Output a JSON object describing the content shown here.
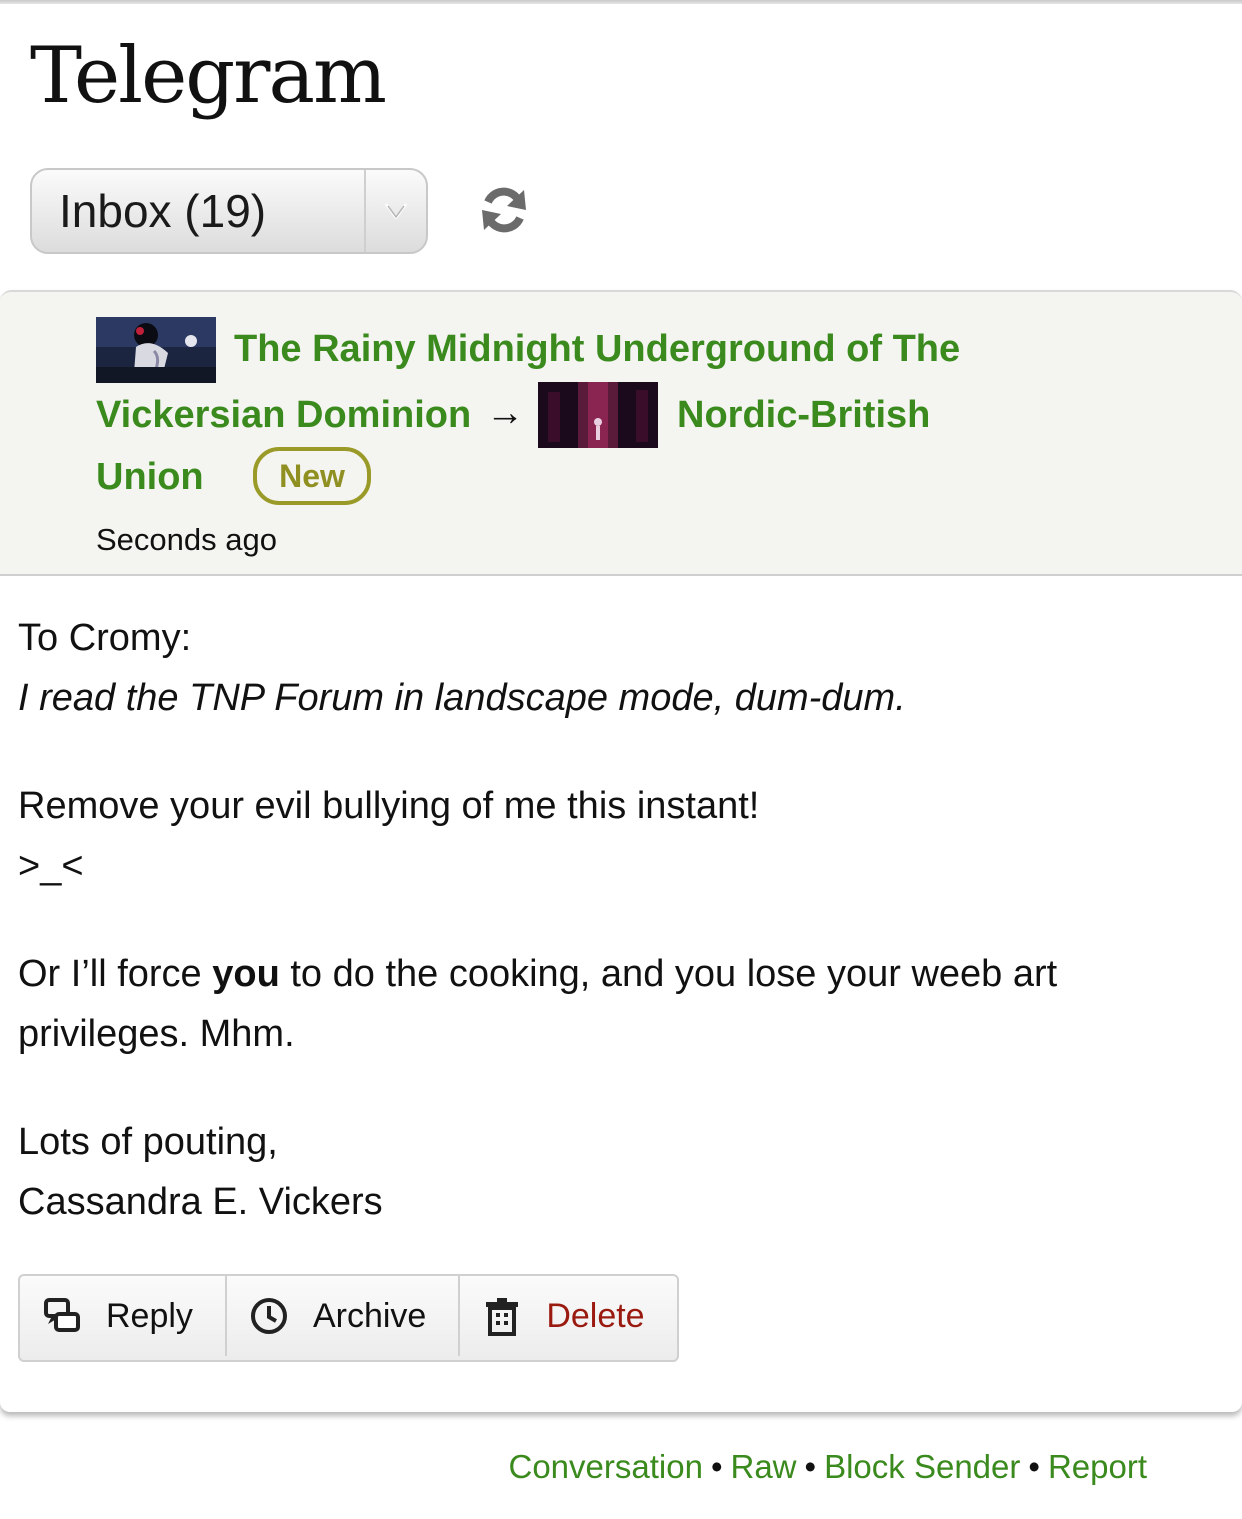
{
  "page": {
    "title": "Telegram"
  },
  "folder": {
    "selected": "Inbox (19)"
  },
  "icons": {
    "refresh": "refresh-icon",
    "dropdown": "chevron-down-icon",
    "reply": "reply-icon",
    "archive": "clock-icon",
    "delete": "trash-icon"
  },
  "telegram": {
    "sender": {
      "name_line1": "The Rainy Midnight Underground of The",
      "name_line2": "Vickersian Dominion"
    },
    "arrow": "→",
    "recipient": {
      "name_line1": "Nordic-British",
      "name_line2": "Union"
    },
    "badge": "New",
    "timestamp": "Seconds ago",
    "body": {
      "greeting": "To Cromy:",
      "italic_line": "I read the TNP Forum in landscape mode, dum-dum.",
      "line3": "Remove your evil bullying of me this instant!",
      "line4": ">_<",
      "line5_pre": "Or I’ll force ",
      "line5_bold": "you",
      "line5_post": " to do the cooking, and you lose your weeb art",
      "line6": "privileges. Mhm.",
      "signoff": "Lots of pouting,",
      "signature": "Cassandra E. Vickers"
    },
    "actions": {
      "reply": "Reply",
      "archive": "Archive",
      "delete": "Delete"
    }
  },
  "footer": {
    "links": [
      "Conversation",
      "Raw",
      "Block Sender",
      "Report"
    ],
    "separator": "•"
  },
  "colors": {
    "link_green": "#3a8a1e",
    "badge_olive": "#9a9a28",
    "delete_red": "#9a1a10",
    "header_bg": "#f4f4f0"
  }
}
